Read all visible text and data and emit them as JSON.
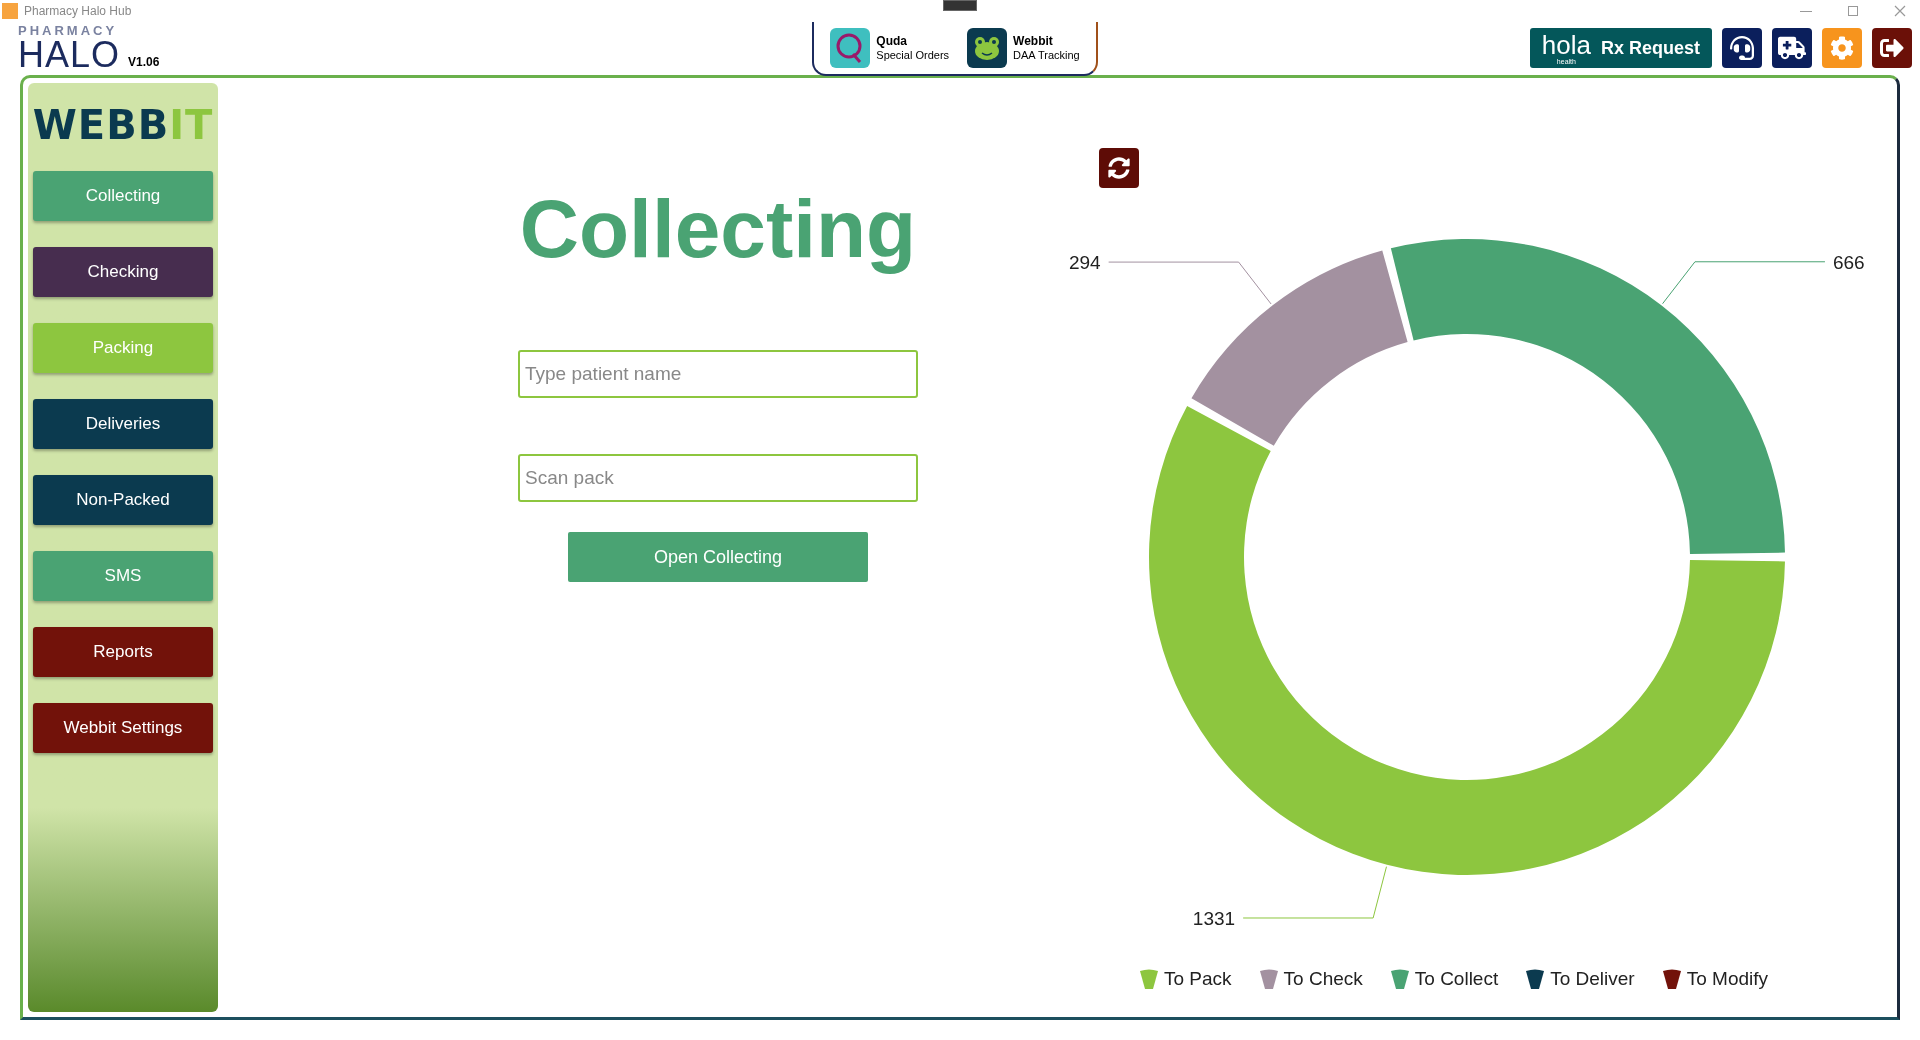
{
  "window": {
    "title": "Pharmacy Halo Hub"
  },
  "logo": {
    "top": "PHARMACY",
    "main": "HALO",
    "version": "V1.06"
  },
  "apps": [
    {
      "name": "Quda",
      "subtitle": "Special Orders",
      "kind": "quda"
    },
    {
      "name": "Webbit",
      "subtitle": "DAA Tracking",
      "kind": "webbit"
    }
  ],
  "hola": {
    "brand": "hola",
    "sub": "health",
    "label": "Rx Request"
  },
  "toolbar": [
    {
      "kind": "support",
      "color": "#0b1f5c"
    },
    {
      "kind": "delivery",
      "color": "#0b1f5c"
    },
    {
      "kind": "settings",
      "color": "#f7941d"
    },
    {
      "kind": "logout",
      "color": "#6b1008"
    }
  ],
  "sidebar": {
    "brand": [
      "WEBB",
      "IT"
    ],
    "items": [
      {
        "label": "Collecting",
        "color": "#4aa373"
      },
      {
        "label": "Checking",
        "color": "#472d4f"
      },
      {
        "label": "Packing",
        "color": "#8dc63f"
      },
      {
        "label": "Deliveries",
        "color": "#0b3a4f"
      },
      {
        "label": "Non-Packed",
        "color": "#0b3a4f"
      },
      {
        "label": "SMS",
        "color": "#4aa373"
      },
      {
        "label": "Reports",
        "color": "#72120a"
      },
      {
        "label": "Webbit Settings",
        "color": "#72120a"
      }
    ]
  },
  "main": {
    "title": "Collecting",
    "fields": [
      {
        "placeholder": "Type patient name"
      },
      {
        "placeholder": "Scan pack"
      }
    ],
    "button": "Open Collecting"
  },
  "chart": {
    "chart_data": {
      "type": "donut",
      "categories": [
        "To Pack",
        "To Check",
        "To Collect",
        "To Deliver",
        "To Modify"
      ],
      "colors": [
        "#8dc63f",
        "#a391a0",
        "#4aa373",
        "#0b3a4f",
        "#72120a"
      ],
      "series": [
        {
          "values": [
            1331,
            294,
            666,
            0,
            0
          ]
        }
      ],
      "data_labels": true
    }
  }
}
